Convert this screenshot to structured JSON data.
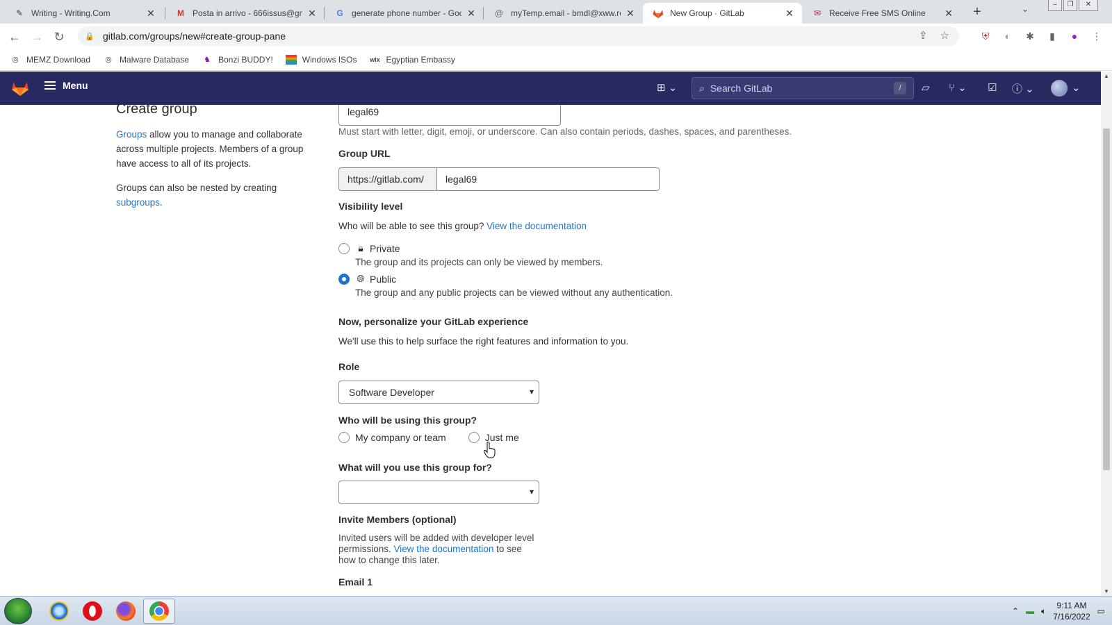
{
  "browser": {
    "tabs": [
      {
        "title": "Writing - Writing.Com",
        "favicon": "pencil-icon",
        "active": false
      },
      {
        "title": "Posta in arrivo - 666issus@gma",
        "favicon": "gmail-icon",
        "active": false
      },
      {
        "title": "generate phone number - Goo",
        "favicon": "google-icon",
        "active": false
      },
      {
        "title": "myTemp.email - bmdl@xww.ro",
        "favicon": "at-icon",
        "active": false
      },
      {
        "title": "New Group · GitLab",
        "favicon": "gitlab-icon",
        "active": true
      },
      {
        "title": "Receive Free SMS Online",
        "favicon": "sms-icon",
        "active": false
      }
    ],
    "url": "gitlab.com/groups/new#create-group-pane",
    "bookmarks": [
      {
        "label": "MEMZ Download",
        "icon": "globe-icon"
      },
      {
        "label": "Malware Database",
        "icon": "globe-icon"
      },
      {
        "label": "Bonzi BUDDY!",
        "icon": "bonzi-icon"
      },
      {
        "label": "Windows ISOs",
        "icon": "windows-icon"
      },
      {
        "label": "Egyptian Embassy",
        "icon": "wix-icon"
      }
    ]
  },
  "header": {
    "menu_label": "Menu",
    "search_placeholder": "Search GitLab",
    "search_shortcut": "/"
  },
  "sidebar": {
    "title": "Create group",
    "p1_link": "Groups",
    "p1_text": " allow you to manage and collaborate across multiple projects. Members of a group have access to all of its projects.",
    "p2_text": "Groups can also be nested by creating ",
    "p2_link": "subgroups",
    "p2_end": "."
  },
  "form": {
    "group_name_value": "legal69",
    "group_name_help": "Must start with letter, digit, emoji, or underscore. Can also contain periods, dashes, spaces, and parentheses.",
    "group_url_label": "Group URL",
    "group_url_prefix": "https://gitlab.com/",
    "group_url_value": "legal69",
    "visibility_label": "Visibility level",
    "visibility_help": "Who will be able to see this group? ",
    "visibility_doc_link": "View the documentation",
    "visibility_options": [
      {
        "label": "Private",
        "desc": "The group and its projects can only be viewed by members.",
        "checked": false,
        "icon": "lock-icon"
      },
      {
        "label": "Public",
        "desc": "The group and any public projects can be viewed without any authentication.",
        "checked": true,
        "icon": "globe-icon"
      }
    ],
    "personalize_heading": "Now, personalize your GitLab experience",
    "personalize_help": "We'll use this to help surface the right features and information to you.",
    "role_label": "Role",
    "role_value": "Software Developer",
    "who_label": "Who will be using this group?",
    "who_options": [
      "My company or team",
      "Just me"
    ],
    "use_label": "What will you use this group for?",
    "use_value": "",
    "invite_heading": "Invite Members (optional)",
    "invite_help_1": "Invited users will be added with developer level permissions. ",
    "invite_doc_link": "View the documentation",
    "invite_help_2": " to see how to change this later.",
    "email_label": "Email 1"
  },
  "taskbar": {
    "time": "9:11 AM",
    "date": "7/16/2022"
  }
}
